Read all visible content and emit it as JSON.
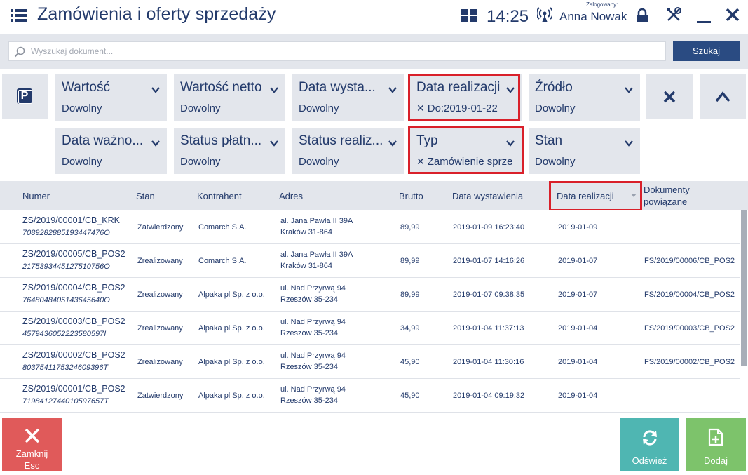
{
  "header": {
    "title": "Zamówienia i oferty sprzedaży",
    "time": "14:25",
    "logged_label": "Zalogowany:",
    "user_name": "Anna Nowak"
  },
  "search": {
    "placeholder": "Wyszukaj dokument...",
    "button_label": "Szukaj"
  },
  "filters": [
    {
      "label": "Wartość",
      "value": "Dowolny",
      "active": false
    },
    {
      "label": "Wartość netto",
      "value": "Dowolny",
      "active": false
    },
    {
      "label": "Data wysta...",
      "value": "Dowolny",
      "active": false
    },
    {
      "label": "Data realizacji",
      "value": "Do:2019-01-22",
      "active": true
    },
    {
      "label": "Źródło",
      "value": "Dowolny",
      "active": false
    },
    {
      "label": "Data ważno...",
      "value": "Dowolny",
      "active": false
    },
    {
      "label": "Status płatn...",
      "value": "Dowolny",
      "active": false
    },
    {
      "label": "Status realiz...",
      "value": "Dowolny",
      "active": false
    },
    {
      "label": "Typ",
      "value": "Zamówienie sprze",
      "active": true
    },
    {
      "label": "Stan",
      "value": "Dowolny",
      "active": false
    }
  ],
  "table": {
    "headers": {
      "numer": "Numer",
      "stan": "Stan",
      "kontrahent": "Kontrahent",
      "adres": "Adres",
      "brutto": "Brutto",
      "data_wystawienia": "Data wystawienia",
      "data_realizacji": "Data realizacji",
      "dokumenty_1": "Dokumenty",
      "dokumenty_2": "powiązane"
    },
    "rows": [
      {
        "numer": "ZS/2019/00001/CB_KRK",
        "kod": "7089282885193447476O",
        "stan": "Zatwierdzony",
        "kontrahent": "Comarch S.A.",
        "adres1": "al. Jana Pawła II 39A",
        "adres2": "Kraków 31-864",
        "brutto": "89,99",
        "data_wystawienia": "2019-01-09 16:23:40",
        "data_realizacji": "2019-01-09",
        "dokumenty": ""
      },
      {
        "numer": "ZS/2019/00005/CB_POS2",
        "kod": "2175393445127510756O",
        "stan": "Zrealizowany",
        "kontrahent": "Comarch S.A.",
        "adres1": "al. Jana Pawła II 39A",
        "adres2": "Kraków 31-864",
        "brutto": "89,99",
        "data_wystawienia": "2019-01-07 14:16:26",
        "data_realizacji": "2019-01-07",
        "dokumenty": "FS/2019/00006/CB_POS2"
      },
      {
        "numer": "ZS/2019/00004/CB_POS2",
        "kod": "7648048405143645640O",
        "stan": "Zrealizowany",
        "kontrahent": "Alpaka pl Sp. z o.o.",
        "adres1": "ul. Nad Przyrwą 94",
        "adres2": "Rzeszów 35-234",
        "brutto": "89,99",
        "data_wystawienia": "2019-01-07 09:38:35",
        "data_realizacji": "2019-01-07",
        "dokumenty": "FS/2019/00004/CB_POS2"
      },
      {
        "numer": "ZS/2019/00003/CB_POS2",
        "kod": "4579436052223580597I",
        "stan": "Zrealizowany",
        "kontrahent": "Alpaka pl Sp. z o.o.",
        "adres1": "ul. Nad Przyrwą 94",
        "adres2": "Rzeszów 35-234",
        "brutto": "34,99",
        "data_wystawienia": "2019-01-04 11:37:13",
        "data_realizacji": "2019-01-04",
        "dokumenty": "FS/2019/00003/CB_POS2"
      },
      {
        "numer": "ZS/2019/00002/CB_POS2",
        "kod": "8037541175324609396T",
        "stan": "Zrealizowany",
        "kontrahent": "Alpaka pl Sp. z o.o.",
        "adres1": "ul. Nad Przyrwą 94",
        "adres2": "Rzeszów 35-234",
        "brutto": "45,90",
        "data_wystawienia": "2019-01-04 11:30:16",
        "data_realizacji": "2019-01-04",
        "dokumenty": "FS/2019/00002/CB_POS2"
      },
      {
        "numer": "ZS/2019/00001/CB_POS2",
        "kod": "7198412744010597657T",
        "stan": "Zatwierdzony",
        "kontrahent": "Alpaka pl Sp. z o.o.",
        "adres1": "ul. Nad Przyrwą 94",
        "adres2": "Rzeszów 35-234",
        "brutto": "45,90",
        "data_wystawienia": "2019-01-04 09:19:32",
        "data_realizacji": "2019-01-04",
        "dokumenty": ""
      }
    ]
  },
  "bottom": {
    "close_label": "Zamknij",
    "close_key": "Esc",
    "refresh_label": "Odśwież",
    "add_label": "Dodaj"
  },
  "colors": {
    "primary": "#233a6b",
    "highlight": "#d9202a",
    "close": "#e05a5a",
    "refresh": "#4fb6b2",
    "add": "#7dc36b"
  },
  "icons": [
    "menu-icon",
    "layout-grid-icon",
    "signal-icon",
    "lock-icon",
    "tools-icon",
    "minimize-icon",
    "close-icon",
    "search-icon",
    "parking-icon",
    "chevron-down-icon",
    "clear-filters-icon",
    "collapse-icon",
    "refresh-icon",
    "add-document-icon"
  ]
}
